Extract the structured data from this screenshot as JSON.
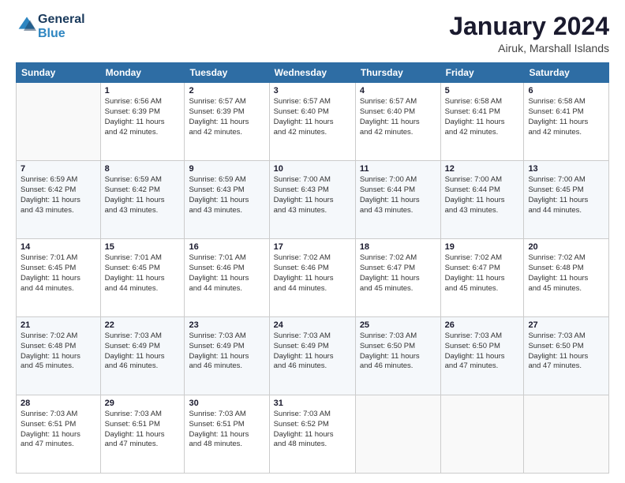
{
  "logo": {
    "line1": "General",
    "line2": "Blue"
  },
  "title": "January 2024",
  "location": "Airuk, Marshall Islands",
  "days_of_week": [
    "Sunday",
    "Monday",
    "Tuesday",
    "Wednesday",
    "Thursday",
    "Friday",
    "Saturday"
  ],
  "weeks": [
    [
      {
        "num": "",
        "detail": ""
      },
      {
        "num": "1",
        "detail": "Sunrise: 6:56 AM\nSunset: 6:39 PM\nDaylight: 11 hours\nand 42 minutes."
      },
      {
        "num": "2",
        "detail": "Sunrise: 6:57 AM\nSunset: 6:39 PM\nDaylight: 11 hours\nand 42 minutes."
      },
      {
        "num": "3",
        "detail": "Sunrise: 6:57 AM\nSunset: 6:40 PM\nDaylight: 11 hours\nand 42 minutes."
      },
      {
        "num": "4",
        "detail": "Sunrise: 6:57 AM\nSunset: 6:40 PM\nDaylight: 11 hours\nand 42 minutes."
      },
      {
        "num": "5",
        "detail": "Sunrise: 6:58 AM\nSunset: 6:41 PM\nDaylight: 11 hours\nand 42 minutes."
      },
      {
        "num": "6",
        "detail": "Sunrise: 6:58 AM\nSunset: 6:41 PM\nDaylight: 11 hours\nand 42 minutes."
      }
    ],
    [
      {
        "num": "7",
        "detail": "Sunrise: 6:59 AM\nSunset: 6:42 PM\nDaylight: 11 hours\nand 43 minutes."
      },
      {
        "num": "8",
        "detail": "Sunrise: 6:59 AM\nSunset: 6:42 PM\nDaylight: 11 hours\nand 43 minutes."
      },
      {
        "num": "9",
        "detail": "Sunrise: 6:59 AM\nSunset: 6:43 PM\nDaylight: 11 hours\nand 43 minutes."
      },
      {
        "num": "10",
        "detail": "Sunrise: 7:00 AM\nSunset: 6:43 PM\nDaylight: 11 hours\nand 43 minutes."
      },
      {
        "num": "11",
        "detail": "Sunrise: 7:00 AM\nSunset: 6:44 PM\nDaylight: 11 hours\nand 43 minutes."
      },
      {
        "num": "12",
        "detail": "Sunrise: 7:00 AM\nSunset: 6:44 PM\nDaylight: 11 hours\nand 43 minutes."
      },
      {
        "num": "13",
        "detail": "Sunrise: 7:00 AM\nSunset: 6:45 PM\nDaylight: 11 hours\nand 44 minutes."
      }
    ],
    [
      {
        "num": "14",
        "detail": "Sunrise: 7:01 AM\nSunset: 6:45 PM\nDaylight: 11 hours\nand 44 minutes."
      },
      {
        "num": "15",
        "detail": "Sunrise: 7:01 AM\nSunset: 6:45 PM\nDaylight: 11 hours\nand 44 minutes."
      },
      {
        "num": "16",
        "detail": "Sunrise: 7:01 AM\nSunset: 6:46 PM\nDaylight: 11 hours\nand 44 minutes."
      },
      {
        "num": "17",
        "detail": "Sunrise: 7:02 AM\nSunset: 6:46 PM\nDaylight: 11 hours\nand 44 minutes."
      },
      {
        "num": "18",
        "detail": "Sunrise: 7:02 AM\nSunset: 6:47 PM\nDaylight: 11 hours\nand 45 minutes."
      },
      {
        "num": "19",
        "detail": "Sunrise: 7:02 AM\nSunset: 6:47 PM\nDaylight: 11 hours\nand 45 minutes."
      },
      {
        "num": "20",
        "detail": "Sunrise: 7:02 AM\nSunset: 6:48 PM\nDaylight: 11 hours\nand 45 minutes."
      }
    ],
    [
      {
        "num": "21",
        "detail": "Sunrise: 7:02 AM\nSunset: 6:48 PM\nDaylight: 11 hours\nand 45 minutes."
      },
      {
        "num": "22",
        "detail": "Sunrise: 7:03 AM\nSunset: 6:49 PM\nDaylight: 11 hours\nand 46 minutes."
      },
      {
        "num": "23",
        "detail": "Sunrise: 7:03 AM\nSunset: 6:49 PM\nDaylight: 11 hours\nand 46 minutes."
      },
      {
        "num": "24",
        "detail": "Sunrise: 7:03 AM\nSunset: 6:49 PM\nDaylight: 11 hours\nand 46 minutes."
      },
      {
        "num": "25",
        "detail": "Sunrise: 7:03 AM\nSunset: 6:50 PM\nDaylight: 11 hours\nand 46 minutes."
      },
      {
        "num": "26",
        "detail": "Sunrise: 7:03 AM\nSunset: 6:50 PM\nDaylight: 11 hours\nand 47 minutes."
      },
      {
        "num": "27",
        "detail": "Sunrise: 7:03 AM\nSunset: 6:50 PM\nDaylight: 11 hours\nand 47 minutes."
      }
    ],
    [
      {
        "num": "28",
        "detail": "Sunrise: 7:03 AM\nSunset: 6:51 PM\nDaylight: 11 hours\nand 47 minutes."
      },
      {
        "num": "29",
        "detail": "Sunrise: 7:03 AM\nSunset: 6:51 PM\nDaylight: 11 hours\nand 47 minutes."
      },
      {
        "num": "30",
        "detail": "Sunrise: 7:03 AM\nSunset: 6:51 PM\nDaylight: 11 hours\nand 48 minutes."
      },
      {
        "num": "31",
        "detail": "Sunrise: 7:03 AM\nSunset: 6:52 PM\nDaylight: 11 hours\nand 48 minutes."
      },
      {
        "num": "",
        "detail": ""
      },
      {
        "num": "",
        "detail": ""
      },
      {
        "num": "",
        "detail": ""
      }
    ]
  ]
}
